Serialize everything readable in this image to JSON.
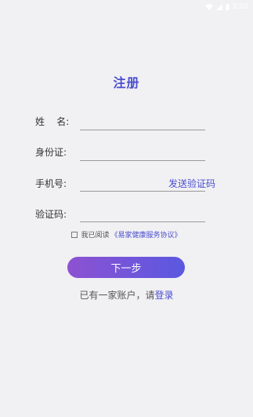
{
  "status_bar": {
    "time": "2:20",
    "icons": [
      "wifi-icon",
      "signal-icon",
      "battery-icon"
    ]
  },
  "page": {
    "title": "注册"
  },
  "form": {
    "name_label": "姓    名:",
    "id_label": "身份证:",
    "phone_label": "手机号:",
    "code_label": "验证码:",
    "send_code_label": "发送验证码"
  },
  "agreement": {
    "prefix": "我已阅读",
    "link": "《易家健康服务协议》",
    "checked": false
  },
  "actions": {
    "next_label": "下一步",
    "login_prefix": "已有一家账户，请",
    "login_link": "登录"
  },
  "colors": {
    "background": "#f1f0f3",
    "accent": "#4a4fcf",
    "button_gradient_start": "#8d52d2",
    "button_gradient_end": "#5a58e0"
  }
}
